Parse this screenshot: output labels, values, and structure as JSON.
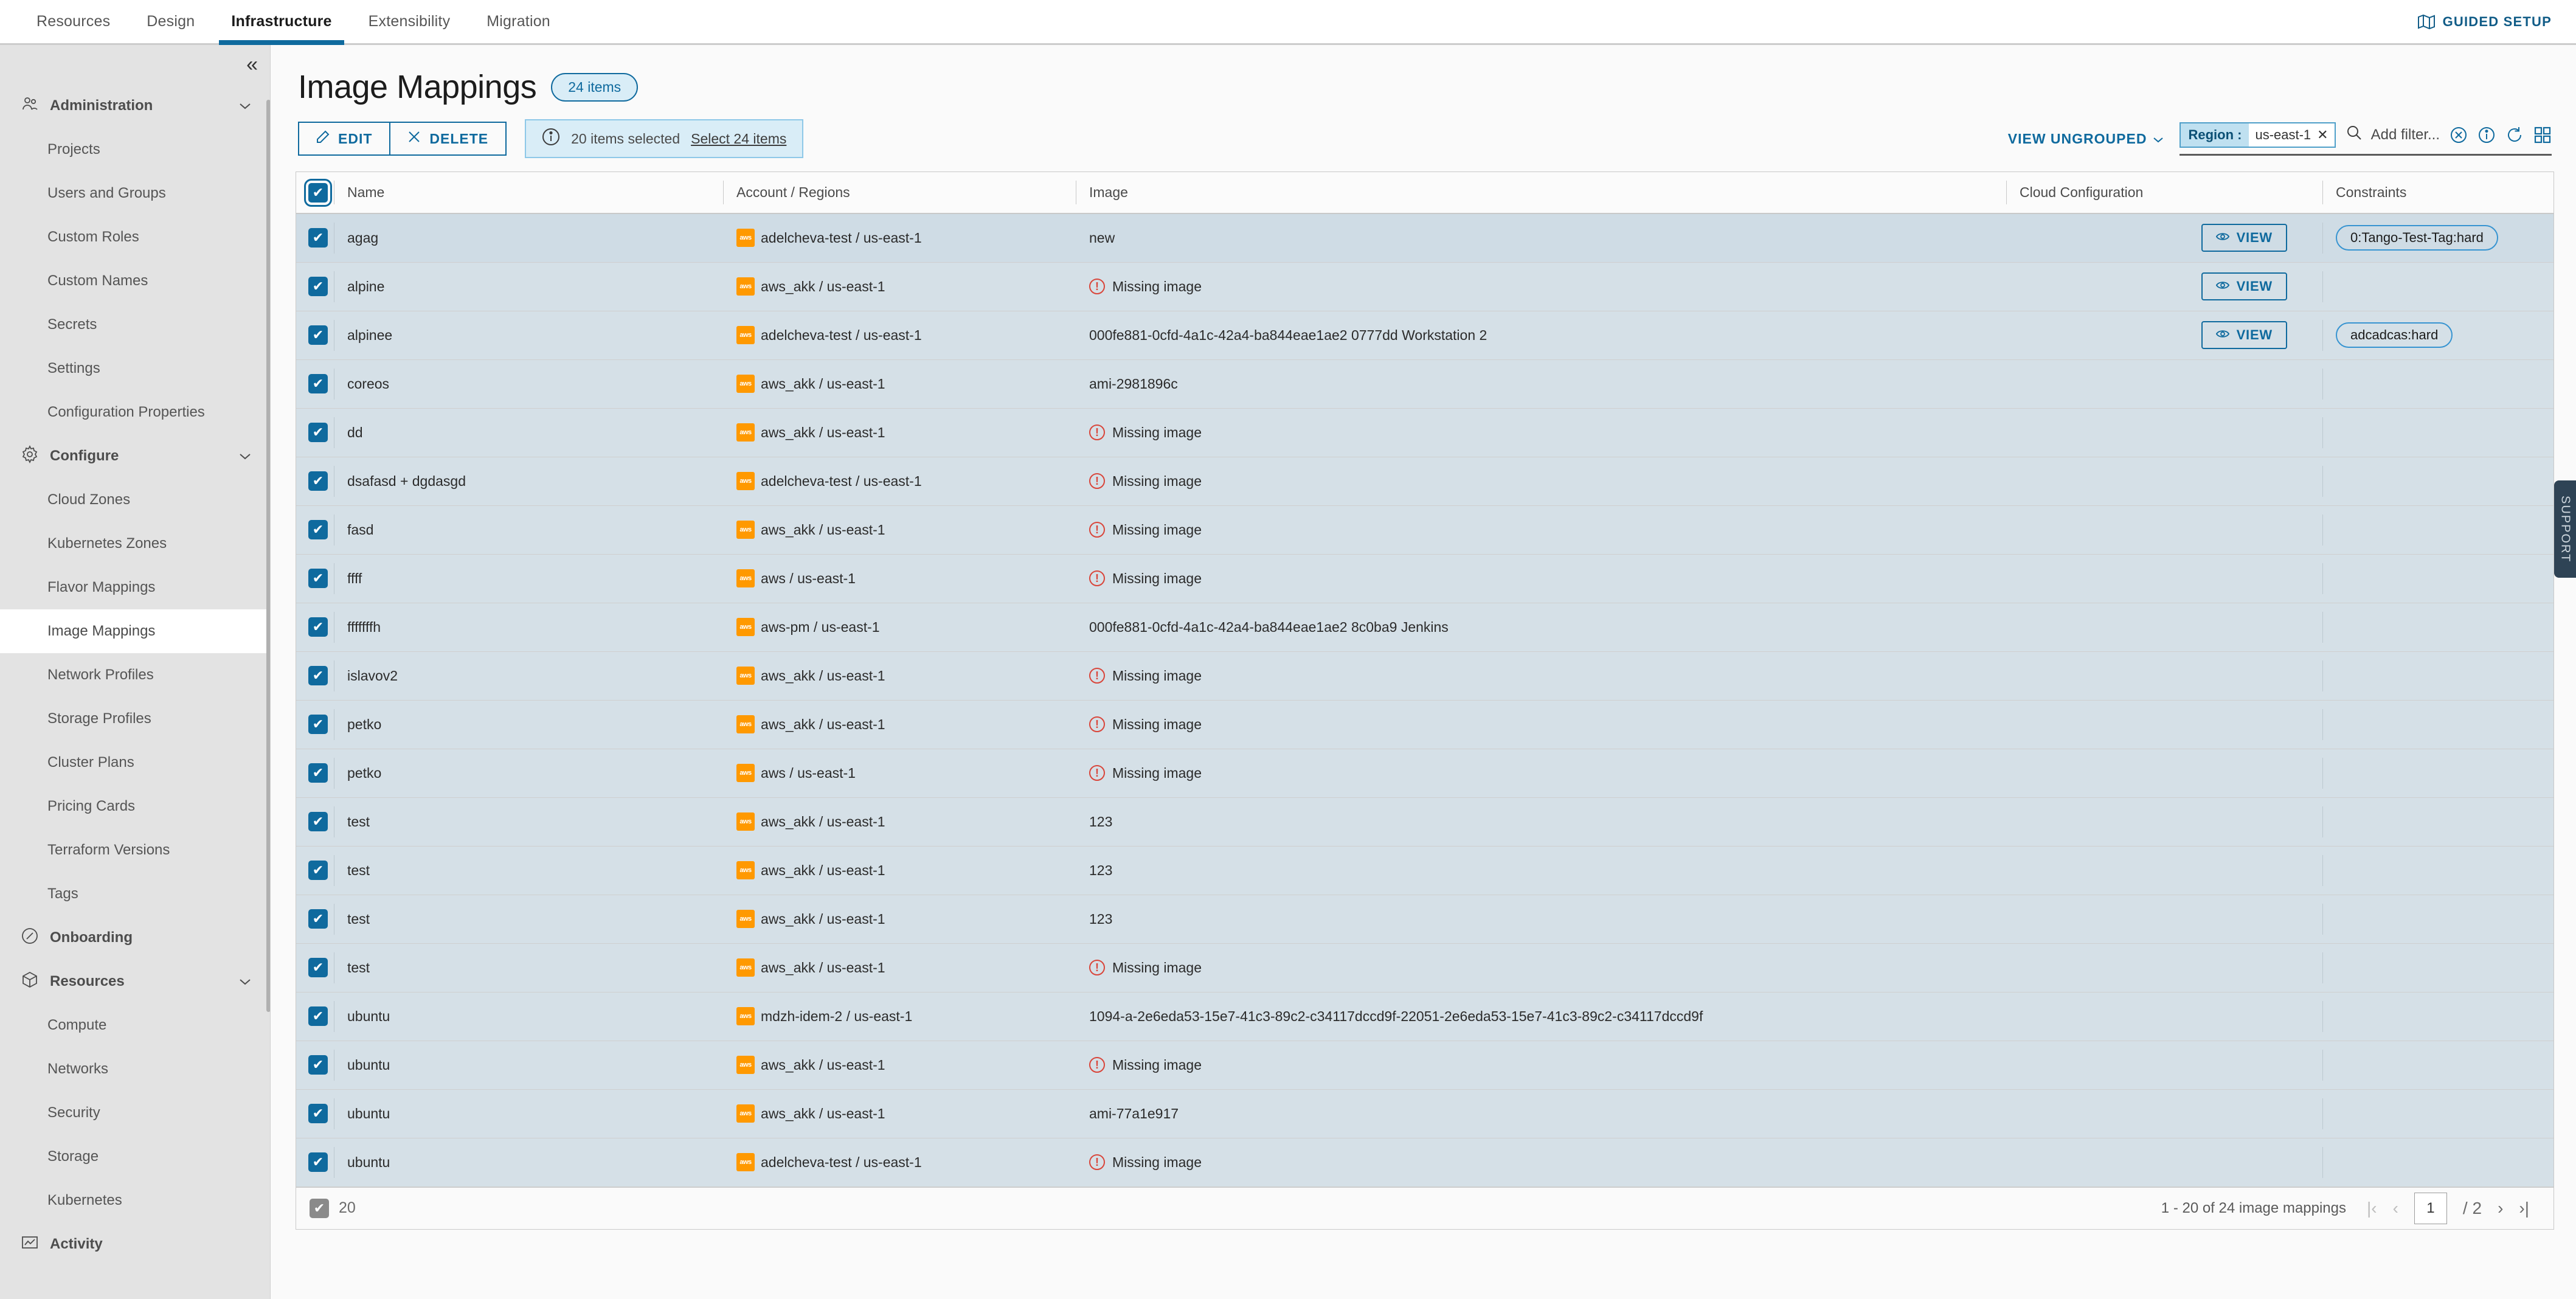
{
  "topnav": {
    "tabs": [
      {
        "label": "Resources",
        "active": false
      },
      {
        "label": "Design",
        "active": false
      },
      {
        "label": "Infrastructure",
        "active": true
      },
      {
        "label": "Extensibility",
        "active": false
      },
      {
        "label": "Migration",
        "active": false
      }
    ],
    "guided_setup_label": "GUIDED SETUP"
  },
  "sidebar": {
    "collapse_icon": "«",
    "groups": [
      {
        "label": "Administration",
        "icon": "users-icon",
        "items": [
          "Projects",
          "Users and Groups",
          "Custom Roles",
          "Custom Names",
          "Secrets",
          "Settings",
          "Configuration Properties"
        ]
      },
      {
        "label": "Configure",
        "icon": "gear-icon",
        "items": [
          "Cloud Zones",
          "Kubernetes Zones",
          "Flavor Mappings",
          "Image Mappings",
          "Network Profiles",
          "Storage Profiles",
          "Cluster Plans",
          "Pricing Cards",
          "Terraform Versions",
          "Tags"
        ]
      },
      {
        "label": "Onboarding",
        "icon": "compass-icon",
        "items": []
      },
      {
        "label": "Resources",
        "icon": "cube-icon",
        "items": [
          "Compute",
          "Networks",
          "Security",
          "Storage",
          "Kubernetes"
        ]
      },
      {
        "label": "Activity",
        "icon": "chart-icon",
        "items": []
      }
    ],
    "active_item": "Image Mappings"
  },
  "page": {
    "title": "Image Mappings",
    "items_badge": "24 items"
  },
  "toolbar": {
    "edit_label": "EDIT",
    "delete_label": "DELETE",
    "selection_text": "20 items selected",
    "select_all_link": "Select 24 items",
    "view_ungrouped_label": "VIEW UNGROUPED",
    "filter_chip": {
      "key": "Region :",
      "value": "us-east-1",
      "remove": "✕"
    },
    "add_filter_placeholder": "Add filter..."
  },
  "table": {
    "columns": [
      "Name",
      "Account / Regions",
      "Image",
      "Cloud Configuration",
      "Constraints"
    ],
    "view_button_label": "VIEW",
    "missing_image_label": "Missing image",
    "rows": [
      {
        "name": "agag",
        "account": "adelcheva-test / us-east-1",
        "image": "new",
        "missing": false,
        "view": true,
        "constraint": "0:Tango-Test-Tag:hard",
        "hover": true
      },
      {
        "name": "alpine",
        "account": "aws_akk / us-east-1",
        "image": "",
        "missing": true,
        "view": true,
        "constraint": ""
      },
      {
        "name": "alpinee",
        "account": "adelcheva-test / us-east-1",
        "image": "000fe881-0cfd-4a1c-42a4-ba844eae1ae2 0777dd Workstation 2",
        "missing": false,
        "view": true,
        "constraint": "adcadcas:hard"
      },
      {
        "name": "coreos",
        "account": "aws_akk / us-east-1",
        "image": "ami-2981896c",
        "missing": false,
        "view": false,
        "constraint": ""
      },
      {
        "name": "dd",
        "account": "aws_akk / us-east-1",
        "image": "",
        "missing": true,
        "view": false,
        "constraint": ""
      },
      {
        "name": "dsafasd + dgdasgd",
        "account": "adelcheva-test / us-east-1",
        "image": "",
        "missing": true,
        "view": false,
        "constraint": ""
      },
      {
        "name": "fasd",
        "account": "aws_akk / us-east-1",
        "image": "",
        "missing": true,
        "view": false,
        "constraint": ""
      },
      {
        "name": "ffff",
        "account": "aws / us-east-1",
        "image": "",
        "missing": true,
        "view": false,
        "constraint": ""
      },
      {
        "name": "fffffffh",
        "account": "aws-pm / us-east-1",
        "image": "000fe881-0cfd-4a1c-42a4-ba844eae1ae2 8c0ba9 Jenkins",
        "missing": false,
        "view": false,
        "constraint": ""
      },
      {
        "name": "islavov2",
        "account": "aws_akk / us-east-1",
        "image": "",
        "missing": true,
        "view": false,
        "constraint": ""
      },
      {
        "name": "petko",
        "account": "aws_akk / us-east-1",
        "image": "",
        "missing": true,
        "view": false,
        "constraint": ""
      },
      {
        "name": "petko",
        "account": "aws / us-east-1",
        "image": "",
        "missing": true,
        "view": false,
        "constraint": ""
      },
      {
        "name": "test",
        "account": "aws_akk / us-east-1",
        "image": "123",
        "missing": false,
        "view": false,
        "constraint": ""
      },
      {
        "name": "test",
        "account": "aws_akk / us-east-1",
        "image": "123",
        "missing": false,
        "view": false,
        "constraint": ""
      },
      {
        "name": "test",
        "account": "aws_akk / us-east-1",
        "image": "123",
        "missing": false,
        "view": false,
        "constraint": ""
      },
      {
        "name": "test",
        "account": "aws_akk / us-east-1",
        "image": "",
        "missing": true,
        "view": false,
        "constraint": ""
      },
      {
        "name": "ubuntu",
        "account": "mdzh-idem-2 / us-east-1",
        "image": "1094-a-2e6eda53-15e7-41c3-89c2-c34117dccd9f-22051-2e6eda53-15e7-41c3-89c2-c34117dccd9f",
        "missing": false,
        "view": false,
        "constraint": ""
      },
      {
        "name": "ubuntu",
        "account": "aws_akk / us-east-1",
        "image": "",
        "missing": true,
        "view": false,
        "constraint": ""
      },
      {
        "name": "ubuntu",
        "account": "aws_akk / us-east-1",
        "image": "ami-77a1e917",
        "missing": false,
        "view": false,
        "constraint": ""
      },
      {
        "name": "ubuntu",
        "account": "adelcheva-test / us-east-1",
        "image": "",
        "missing": true,
        "view": false,
        "constraint": ""
      }
    ]
  },
  "footer": {
    "selected_count": "20",
    "range_text": "1 - 20 of 24 image mappings",
    "page_value": "1",
    "page_total": "/ 2",
    "first_icon": "|‹",
    "prev_icon": "‹",
    "next_icon": "›",
    "last_icon": "›|"
  },
  "support": {
    "label": "SUPPORT",
    "chevron": "«"
  },
  "colors": {
    "accent": "#0f6a9e",
    "aws_orange": "#ff9900",
    "row_selected": "#d5e0e7",
    "warn_red": "#d9453a"
  }
}
